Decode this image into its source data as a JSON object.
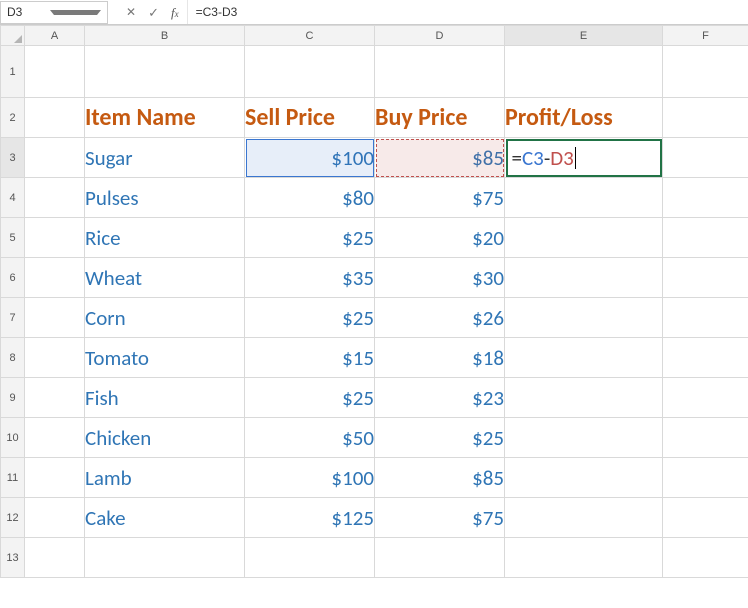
{
  "name_box": "D3",
  "formula_bar": {
    "value": "=C3-D3"
  },
  "columns": [
    "A",
    "B",
    "C",
    "D",
    "E",
    "F"
  ],
  "row_numbers": [
    1,
    2,
    3,
    4,
    5,
    6,
    7,
    8,
    9,
    10,
    11,
    12,
    13
  ],
  "headers": {
    "item": "Item Name",
    "sell": "Sell Price",
    "buy": "Buy Price",
    "pl": "Profit/Loss"
  },
  "formula_cell": {
    "eq": "=",
    "ref1": "C3",
    "dash": "-",
    "ref2": "D3"
  },
  "rows": [
    {
      "item": "Sugar",
      "sell": "$100",
      "buy": "$85"
    },
    {
      "item": "Pulses",
      "sell": "$80",
      "buy": "$75"
    },
    {
      "item": "Rice",
      "sell": "$25",
      "buy": "$20"
    },
    {
      "item": "Wheat",
      "sell": "$35",
      "buy": "$30"
    },
    {
      "item": "Corn",
      "sell": "$25",
      "buy": "$26"
    },
    {
      "item": "Tomato",
      "sell": "$15",
      "buy": "$18"
    },
    {
      "item": "Fish",
      "sell": "$25",
      "buy": "$23"
    },
    {
      "item": "Chicken",
      "sell": "$50",
      "buy": "$25"
    },
    {
      "item": "Lamb",
      "sell": "$100",
      "buy": "$85"
    },
    {
      "item": "Cake",
      "sell": "$125",
      "buy": "$75"
    }
  ],
  "chart_data": {
    "type": "table",
    "title": "",
    "columns": [
      "Item Name",
      "Sell Price",
      "Buy Price",
      "Profit/Loss"
    ],
    "data": [
      {
        "Item Name": "Sugar",
        "Sell Price": 100,
        "Buy Price": 85,
        "Profit/Loss": null
      },
      {
        "Item Name": "Pulses",
        "Sell Price": 80,
        "Buy Price": 75,
        "Profit/Loss": null
      },
      {
        "Item Name": "Rice",
        "Sell Price": 25,
        "Buy Price": 20,
        "Profit/Loss": null
      },
      {
        "Item Name": "Wheat",
        "Sell Price": 35,
        "Buy Price": 30,
        "Profit/Loss": null
      },
      {
        "Item Name": "Corn",
        "Sell Price": 25,
        "Buy Price": 26,
        "Profit/Loss": null
      },
      {
        "Item Name": "Tomato",
        "Sell Price": 15,
        "Buy Price": 18,
        "Profit/Loss": null
      },
      {
        "Item Name": "Fish",
        "Sell Price": 25,
        "Buy Price": 23,
        "Profit/Loss": null
      },
      {
        "Item Name": "Chicken",
        "Sell Price": 50,
        "Buy Price": 25,
        "Profit/Loss": null
      },
      {
        "Item Name": "Lamb",
        "Sell Price": 100,
        "Buy Price": 85,
        "Profit/Loss": null
      },
      {
        "Item Name": "Cake",
        "Sell Price": 125,
        "Buy Price": 75,
        "Profit/Loss": null
      }
    ],
    "formula_in_E3": "=C3-D3"
  }
}
